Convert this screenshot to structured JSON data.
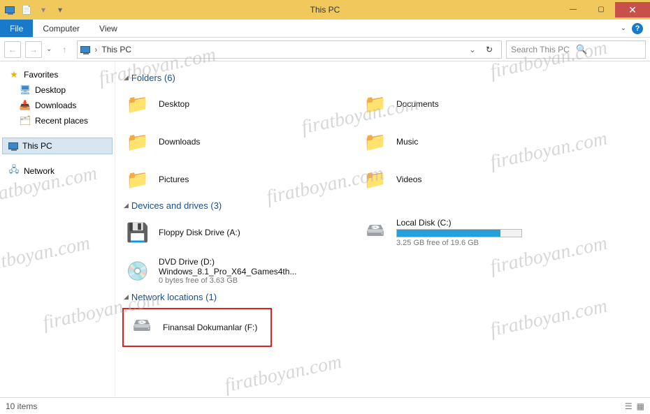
{
  "window": {
    "title": "This PC"
  },
  "ribbon": {
    "file": "File",
    "computer": "Computer",
    "view": "View"
  },
  "address": {
    "location": "This PC"
  },
  "search": {
    "placeholder": "Search This PC"
  },
  "sidebar": {
    "favorites": {
      "label": "Favorites",
      "items": [
        {
          "label": "Desktop"
        },
        {
          "label": "Downloads"
        },
        {
          "label": "Recent places"
        }
      ]
    },
    "thispc": {
      "label": "This PC"
    },
    "network": {
      "label": "Network"
    }
  },
  "groups": {
    "folders": {
      "header": "Folders (6)",
      "items": [
        {
          "label": "Desktop"
        },
        {
          "label": "Documents"
        },
        {
          "label": "Downloads"
        },
        {
          "label": "Music"
        },
        {
          "label": "Pictures"
        },
        {
          "label": "Videos"
        }
      ]
    },
    "drives": {
      "header": "Devices and drives (3)",
      "items": [
        {
          "label": "Floppy Disk Drive (A:)"
        },
        {
          "label": "Local Disk (C:)",
          "sub": "3.25 GB free of 19.6 GB",
          "fill_pct": 83
        },
        {
          "label": "DVD Drive (D:)",
          "line2": "Windows_8.1_Pro_X64_Games4th...",
          "sub": "0 bytes free of 3.63 GB"
        }
      ]
    },
    "network": {
      "header": "Network locations (1)",
      "items": [
        {
          "label": "Finansal Dokumanlar (F:)"
        }
      ]
    }
  },
  "status": {
    "count": "10 items"
  },
  "watermark_text": "firatboyan.com"
}
